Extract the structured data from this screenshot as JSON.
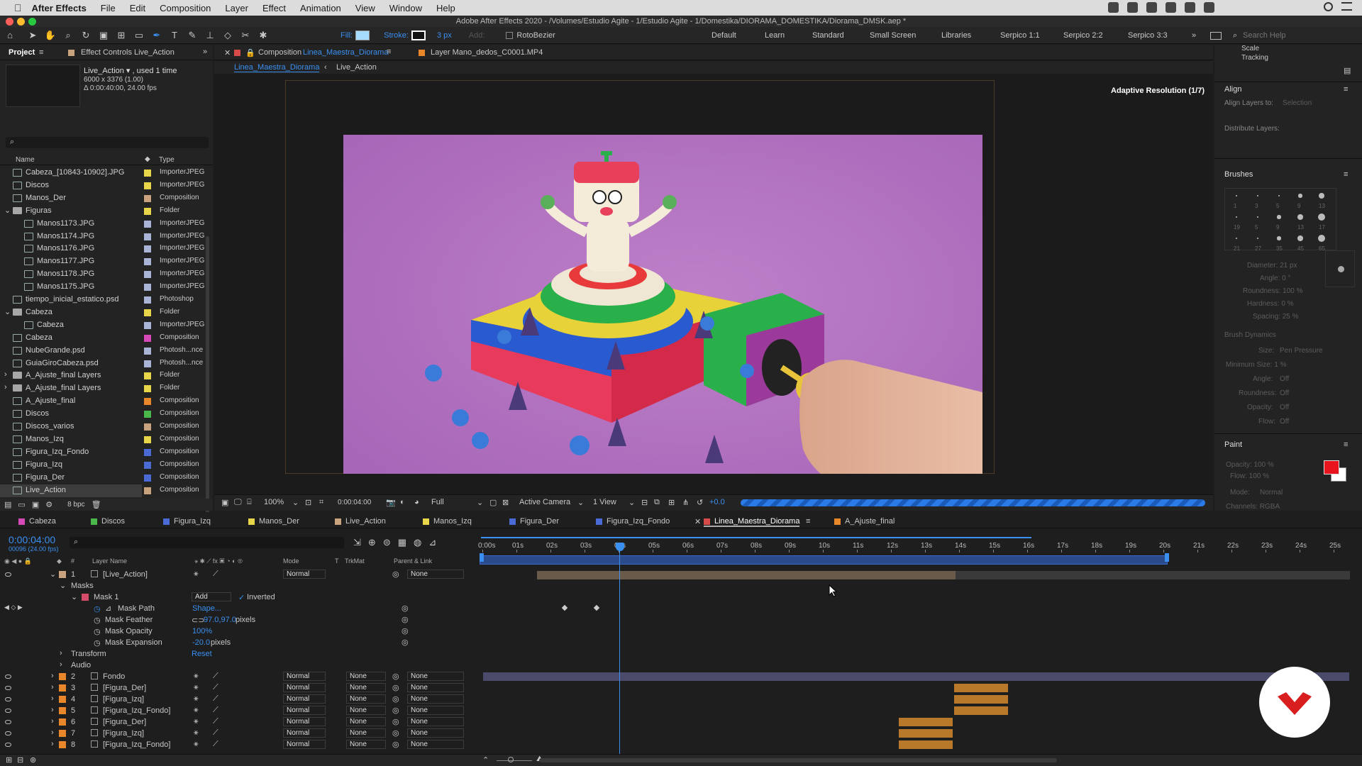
{
  "menubar": {
    "app": "After Effects",
    "items": [
      "File",
      "Edit",
      "Composition",
      "Layer",
      "Effect",
      "Animation",
      "View",
      "Window",
      "Help"
    ]
  },
  "window_title": "Adobe After Effects 2020 - /Volumes/Estudio Agite - 1/Estudio Agite - 1/Domestika/DIORAMA_DOMESTIKA/Diorama_DMSK.aep *",
  "toolbar": {
    "fill_label": "Fill:",
    "stroke_label": "Stroke:",
    "stroke_width": "3 px",
    "add_label": "Add:",
    "rotobezier": "RotoBezier",
    "fill_color": "#a8dcff",
    "search_placeholder": "Search Help",
    "workspaces": [
      "Default",
      "Learn",
      "Standard",
      "Small Screen",
      "Libraries",
      "Serpico 1:1",
      "Serpico 2:2",
      "Serpico 3:3"
    ]
  },
  "project": {
    "tab": "Project",
    "effect_controls_tab": "Effect Controls Live_Action",
    "selected_name": "Live_Action ▾ , used 1 time",
    "selected_dims": "6000 x 3376 (1.00)",
    "selected_duration": "Δ 0:00:40:00, 24.00 fps",
    "col_name": "Name",
    "col_type": "Type",
    "bpc": "8 bpc",
    "items": [
      {
        "name": "Cabeza_[10843-10902].JPG",
        "type": "ImporterJPEG",
        "kind": "file",
        "indent": 0,
        "color": "#e8d64a",
        "twirl": ""
      },
      {
        "name": "Discos",
        "type": "ImporterJPEG",
        "kind": "file",
        "indent": 0,
        "color": "#e8d64a",
        "twirl": ""
      },
      {
        "name": "Manos_Der",
        "type": "Composition",
        "kind": "comp",
        "indent": 0,
        "color": "#c9a27e",
        "twirl": ""
      },
      {
        "name": "Figuras",
        "type": "Folder",
        "kind": "folder",
        "indent": 0,
        "color": "#e8d64a",
        "twirl": "⌄"
      },
      {
        "name": "Manos1173.JPG",
        "type": "ImporterJPEG",
        "kind": "file",
        "indent": 1,
        "color": "#a9b4d6",
        "twirl": ""
      },
      {
        "name": "Manos1174.JPG",
        "type": "ImporterJPEG",
        "kind": "file",
        "indent": 1,
        "color": "#a9b4d6",
        "twirl": ""
      },
      {
        "name": "Manos1176.JPG",
        "type": "ImporterJPEG",
        "kind": "file",
        "indent": 1,
        "color": "#a9b4d6",
        "twirl": ""
      },
      {
        "name": "Manos1177.JPG",
        "type": "ImporterJPEG",
        "kind": "file",
        "indent": 1,
        "color": "#a9b4d6",
        "twirl": ""
      },
      {
        "name": "Manos1178.JPG",
        "type": "ImporterJPEG",
        "kind": "file",
        "indent": 1,
        "color": "#a9b4d6",
        "twirl": ""
      },
      {
        "name": "Manos1175.JPG",
        "type": "ImporterJPEG",
        "kind": "file",
        "indent": 1,
        "color": "#a9b4d6",
        "twirl": ""
      },
      {
        "name": "tiempo_inicial_estatico.psd",
        "type": "Photoshop",
        "kind": "file",
        "indent": 0,
        "color": "#a9b4d6",
        "twirl": ""
      },
      {
        "name": "Cabeza",
        "type": "Folder",
        "kind": "folder",
        "indent": 0,
        "color": "#e8d64a",
        "twirl": "⌄"
      },
      {
        "name": "Cabeza",
        "type": "ImporterJPEG",
        "kind": "file",
        "indent": 1,
        "color": "#a9b4d6",
        "twirl": ""
      },
      {
        "name": "Cabeza",
        "type": "Composition",
        "kind": "comp",
        "indent": 0,
        "color": "#d64ab8",
        "twirl": ""
      },
      {
        "name": "NubeGrande.psd",
        "type": "Photosh...nce",
        "kind": "file",
        "indent": 0,
        "color": "#a9b4d6",
        "twirl": ""
      },
      {
        "name": "GuiaGiroCabeza.psd",
        "type": "Photosh...nce",
        "kind": "file",
        "indent": 0,
        "color": "#a9b4d6",
        "twirl": ""
      },
      {
        "name": "A_Ajuste_final Layers",
        "type": "Folder",
        "kind": "folder",
        "indent": 0,
        "color": "#e8d64a",
        "twirl": "›"
      },
      {
        "name": "A_Ajuste_final Layers",
        "type": "Folder",
        "kind": "folder",
        "indent": 0,
        "color": "#e8d64a",
        "twirl": "›"
      },
      {
        "name": "A_Ajuste_final",
        "type": "Composition",
        "kind": "comp",
        "indent": 0,
        "color": "#e8862a",
        "twirl": ""
      },
      {
        "name": "Discos",
        "type": "Composition",
        "kind": "comp",
        "indent": 0,
        "color": "#4ab84a",
        "twirl": ""
      },
      {
        "name": "Discos_varios",
        "type": "Composition",
        "kind": "comp",
        "indent": 0,
        "color": "#c9a27e",
        "twirl": ""
      },
      {
        "name": "Manos_Izq",
        "type": "Composition",
        "kind": "comp",
        "indent": 0,
        "color": "#e8d64a",
        "twirl": ""
      },
      {
        "name": "Figura_Izq_Fondo",
        "type": "Composition",
        "kind": "comp",
        "indent": 0,
        "color": "#4a6ad6",
        "twirl": ""
      },
      {
        "name": "Figura_Izq",
        "type": "Composition",
        "kind": "comp",
        "indent": 0,
        "color": "#4a6ad6",
        "twirl": ""
      },
      {
        "name": "Figura_Der",
        "type": "Composition",
        "kind": "comp",
        "indent": 0,
        "color": "#4a6ad6",
        "twirl": ""
      },
      {
        "name": "Live_Action",
        "type": "Composition",
        "kind": "comp",
        "indent": 0,
        "color": "#c9a27e",
        "twirl": ""
      }
    ]
  },
  "viewer": {
    "comp_tab": "Composition",
    "comp_name": "Linea_Maestra_Diorama",
    "layer_tab": "Layer Mano_dedos_C0001.MP4",
    "breadcrumb_1": "Linea_Maestra_Diorama",
    "breadcrumb_2": "Live_Action",
    "adaptive": "Adaptive Resolution (1/7)",
    "zoom": "100%",
    "time": "0:00:04:00",
    "resolution": "Full",
    "camera": "Active Camera",
    "views": "1 View",
    "exposure": "+0.0"
  },
  "right_panel": {
    "scale": "Scale",
    "tracking": "Tracking",
    "align_title": "Align",
    "align_to": "Align Layers to:",
    "align_to_value": "Selection",
    "distribute": "Distribute Layers:",
    "brushes_title": "Brushes",
    "brush_sizes": [
      "1",
      "3",
      "5",
      "9",
      "13",
      "19",
      "5",
      "9",
      "13",
      "17",
      "21",
      "27",
      "35",
      "45",
      "65"
    ],
    "diameter": "Diameter: 21 px",
    "angle": "Angle: 0 °",
    "roundness": "Roundness: 100 %",
    "hardness": "Hardness: 0 %",
    "spacing": "Spacing: 25 %",
    "brush_dynamics": "Brush Dynamics",
    "size": "Size:",
    "size_value": "Pen Pressure",
    "min_size": "Minimum Size: 1 %",
    "angle_d": "Angle:",
    "roundness_d": "Roundness:",
    "opacity_d": "Opacity:",
    "flow_d": "Flow:",
    "off": "Off",
    "paint_title": "Paint",
    "paint_opacity": "Opacity: 100 %",
    "paint_flow": "Flow: 100 %",
    "paint_mode": "Mode:",
    "paint_mode_value": "Normal",
    "channels": "Channels: RGBA",
    "paint_fg": "#e8141e",
    "paint_bg": "#ffffff"
  },
  "timeline": {
    "tabs": [
      {
        "name": "Cabeza",
        "color": "#d64ab8"
      },
      {
        "name": "Discos",
        "color": "#4ab84a"
      },
      {
        "name": "Figura_Izq",
        "color": "#4a6ad6"
      },
      {
        "name": "Manos_Der",
        "color": "#e8d64a"
      },
      {
        "name": "Live_Action",
        "color": "#c9a27e"
      },
      {
        "name": "Manos_Izq",
        "color": "#e8d64a"
      },
      {
        "name": "Figura_Der",
        "color": "#4a6ad6"
      },
      {
        "name": "Figura_Izq_Fondo",
        "color": "#4a6ad6"
      },
      {
        "name": "Linea_Maestra_Diorama",
        "color": "#d64a4a"
      },
      {
        "name": "A_Ajuste_final",
        "color": "#e8862a"
      }
    ],
    "timecode": "0:00:04:00",
    "frame_info": "00096 (24.00 fps)",
    "col_layer_name": "Layer Name",
    "col_mode": "Mode",
    "col_t": "T",
    "col_trkmat": "TrkMat",
    "col_parent": "Parent & Link",
    "ruler": [
      "0:00s",
      "01s",
      "02s",
      "03s",
      "04s",
      "05s",
      "06s",
      "07s",
      "08s",
      "09s",
      "10s",
      "11s",
      "12s",
      "13s",
      "14s",
      "15s",
      "16s",
      "17s",
      "18s",
      "19s",
      "20s",
      "21s",
      "22s",
      "23s",
      "24s",
      "25s"
    ],
    "layer1": {
      "num": "1",
      "name": "[Live_Action]",
      "mode": "Normal",
      "parent": "None",
      "color": "#c9a27e"
    },
    "masks_label": "Masks",
    "mask1": "Mask 1",
    "mask_mode": "Add",
    "inverted": "Inverted",
    "mask_path": "Mask Path",
    "mask_path_value": "Shape...",
    "mask_feather": "Mask Feather",
    "mask_feather_value": "97.0,97.0",
    "mask_feather_unit": "pixels",
    "mask_opacity": "Mask Opacity",
    "mask_opacity_value": "100%",
    "mask_expansion": "Mask Expansion",
    "mask_expansion_value": "-20.0",
    "mask_expansion_unit": "pixels",
    "transform": "Transform",
    "transform_reset": "Reset",
    "audio": "Audio",
    "layers": [
      {
        "num": "2",
        "name": "Fondo",
        "mode": "Normal",
        "trkmat": "None",
        "parent": "None",
        "color": "#e8862a"
      },
      {
        "num": "3",
        "name": "[Figura_Der]",
        "mode": "Normal",
        "trkmat": "None",
        "parent": "None",
        "color": "#e8862a"
      },
      {
        "num": "4",
        "name": "[Figura_Izq]",
        "mode": "Normal",
        "trkmat": "None",
        "parent": "None",
        "color": "#e8862a"
      },
      {
        "num": "5",
        "name": "[Figura_Izq_Fondo]",
        "mode": "Normal",
        "trkmat": "None",
        "parent": "None",
        "color": "#e8862a"
      },
      {
        "num": "6",
        "name": "[Figura_Der]",
        "mode": "Normal",
        "trkmat": "None",
        "parent": "None",
        "color": "#e8862a"
      },
      {
        "num": "7",
        "name": "[Figura_Izq]",
        "mode": "Normal",
        "trkmat": "None",
        "parent": "None",
        "color": "#e8862a"
      },
      {
        "num": "8",
        "name": "[Figura_Izq_Fondo]",
        "mode": "Normal",
        "trkmat": "None",
        "parent": "None",
        "color": "#e8862a"
      }
    ]
  },
  "badge_color": "#d81e1e"
}
